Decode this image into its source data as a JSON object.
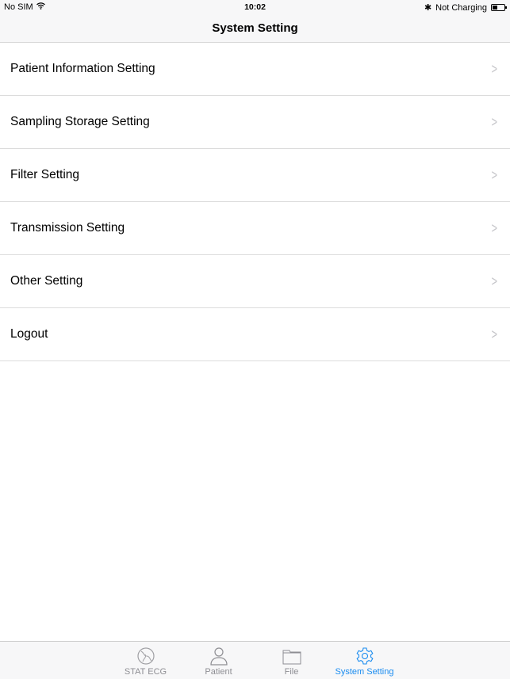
{
  "status": {
    "carrier": "No SIM",
    "time": "10:02",
    "charging": "Not Charging",
    "battery_level": 0.4
  },
  "nav": {
    "title": "System Setting"
  },
  "items": [
    {
      "label": "Patient Information Setting"
    },
    {
      "label": "Sampling Storage Setting"
    },
    {
      "label": "Filter Setting"
    },
    {
      "label": "Transmission Setting"
    },
    {
      "label": "Other Setting"
    },
    {
      "label": "Logout"
    }
  ],
  "tabs": [
    {
      "label": "STAT ECG",
      "icon": "globe-icon"
    },
    {
      "label": "Patient",
      "icon": "person-icon"
    },
    {
      "label": "File",
      "icon": "folder-icon"
    },
    {
      "label": "System Setting",
      "icon": "gear-icon",
      "active": true
    }
  ],
  "colors": {
    "accent": "#1a8cf0"
  }
}
